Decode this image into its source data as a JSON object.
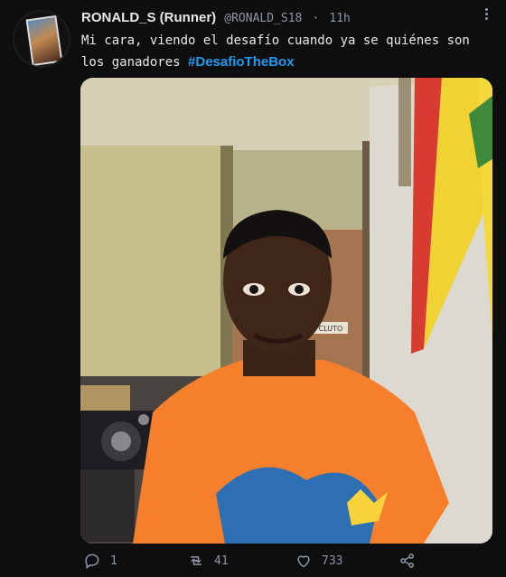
{
  "tweet": {
    "display_name": "RONALD_S (Runner)",
    "handle": "@RONALD_S18",
    "separator": "·",
    "time": "11h",
    "text_part1": "Mi cara, viendo el desafío cuando ya se quiénes son",
    "text_part2": "los ganadores",
    "hashtag": "#DesafioTheBox",
    "door_sign": "CLUTO"
  },
  "actions": {
    "replies": "1",
    "retweets": "41",
    "likes": "733"
  },
  "icons": {
    "reply": "reply-icon",
    "retweet": "retweet-icon",
    "like": "heart-icon",
    "share": "share-icon",
    "more": "more-icon"
  },
  "colors": {
    "background": "#0e0e0f",
    "hashtag": "#1d9bf0",
    "muted": "#8b98a5",
    "shirt": "#f57f2a"
  }
}
